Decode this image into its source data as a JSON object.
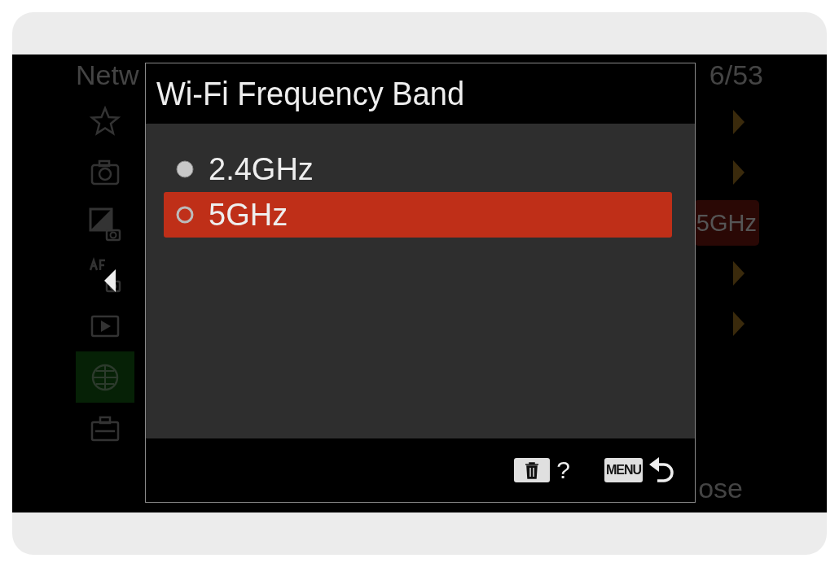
{
  "background_menu": {
    "title": "Netw",
    "page": "6/53",
    "sidebar": [
      {
        "kind": "star",
        "selected": false
      },
      {
        "kind": "camera",
        "selected": false
      },
      {
        "kind": "exposure",
        "selected": false
      },
      {
        "kind": "af-mf",
        "selected": false
      },
      {
        "kind": "playback",
        "selected": false
      },
      {
        "kind": "network",
        "selected": true
      },
      {
        "kind": "toolbox",
        "selected": false
      }
    ],
    "values": [
      {
        "kind": "arrow"
      },
      {
        "kind": "arrow"
      },
      {
        "kind": "value",
        "text": "5GHz"
      },
      {
        "kind": "arrow"
      },
      {
        "kind": "arrow"
      }
    ],
    "close_text": "ose"
  },
  "dialog": {
    "title": "Wi-Fi Frequency Band",
    "options": [
      {
        "label": "2.4GHz",
        "selected": false
      },
      {
        "label": "5GHz",
        "selected": true
      }
    ],
    "footer": [
      {
        "kind": "delete",
        "key_text": "?"
      },
      {
        "kind": "menu",
        "key": "MENU"
      }
    ]
  }
}
